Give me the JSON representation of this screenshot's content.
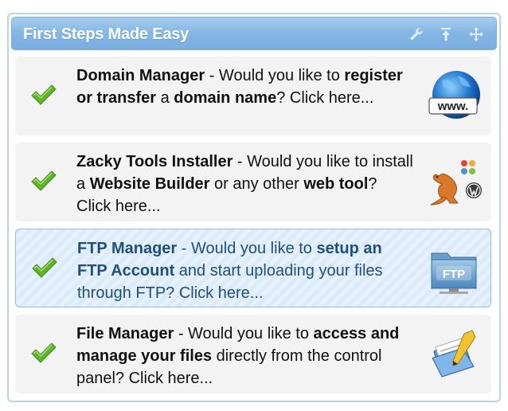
{
  "widget": {
    "title": "First Steps Made Easy",
    "header_icons": [
      "wrench-icon",
      "collapse-to-top-icon",
      "move-icon"
    ]
  },
  "items": [
    {
      "title": "Domain Manager",
      "parts": [
        " - Would you like to ",
        "register or transfer",
        " a ",
        "domain name",
        "? Click here..."
      ],
      "icon": "www-globe-icon",
      "active": false
    },
    {
      "title": "Zacky Tools Installer",
      "parts": [
        " - Would you like to install a ",
        "Website Builder",
        " or any other ",
        "web tool",
        "? Click here..."
      ],
      "icon": "kangaroo-tools-icon",
      "active": false
    },
    {
      "title": "FTP Manager",
      "parts": [
        " - Would you like to ",
        "setup an FTP Account",
        " and start uploading your files through FTP? Click here..."
      ],
      "icon": "ftp-folder-icon",
      "active": true
    },
    {
      "title": "File Manager",
      "parts": [
        " - Would you like to ",
        "access and manage your files",
        " directly from the control panel? Click here..."
      ],
      "icon": "file-manager-icon",
      "active": false
    }
  ],
  "icon_labels": {
    "www": "www.",
    "ftp": "FTP"
  },
  "colors": {
    "header": "#84b6e3",
    "active_text": "#1f4f7a",
    "check_green": "#5fb52a"
  }
}
